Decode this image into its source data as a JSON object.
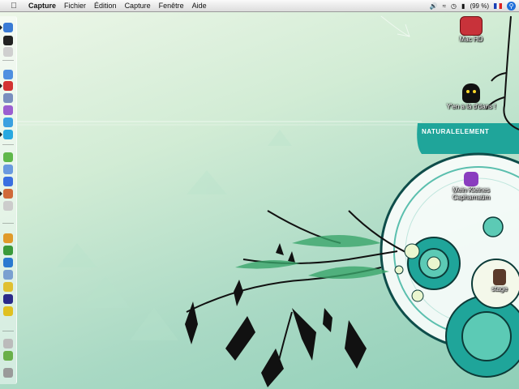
{
  "menubar": {
    "apple_icon": "apple-icon",
    "app_name": "Capture",
    "menus": [
      "Fichier",
      "Édition",
      "Capture",
      "Fenêtre",
      "Aide"
    ],
    "battery": "(99 %)",
    "status_icons": [
      "volume-icon",
      "wifi-icon",
      "clock-icon",
      "battery-icon",
      "flag-fr-icon",
      "spotlight-icon"
    ]
  },
  "desktop": {
    "icons": [
      {
        "label": "Mac HD",
        "icon": "hard-drive-icon"
      },
      {
        "label": "Y'en a là d'dans !",
        "icon": "folder-icon"
      },
      {
        "label": "Mein Kleines Capharnaüm",
        "icon": "folder-icon"
      },
      {
        "label": "stage",
        "icon": "folder-icon"
      }
    ],
    "wallpaper_logo": "NATURALELEMENT"
  },
  "dock": {
    "items": [
      {
        "name": "finder-icon",
        "color": "#3a7bd5"
      },
      {
        "name": "dashboard-icon",
        "color": "#222222"
      },
      {
        "name": "preview-icon",
        "color": "#cfcfcf"
      },
      {
        "name": "safari-icon",
        "color": "#4f8fe0"
      },
      {
        "name": "adium-icon",
        "color": "#d33333"
      },
      {
        "name": "mail-icon",
        "color": "#7a8fbf"
      },
      {
        "name": "ichat-icon",
        "color": "#9b5fd0"
      },
      {
        "name": "network-icon",
        "color": "#3aa0e0"
      },
      {
        "name": "skype-icon",
        "color": "#29a8e0"
      },
      {
        "name": "itunes-icon",
        "color": "#5fb84a"
      },
      {
        "name": "iphoto-icon",
        "color": "#6a9adf"
      },
      {
        "name": "browser-icon",
        "color": "#3a6fe0"
      },
      {
        "name": "utility-icon",
        "color": "#d06a3a"
      },
      {
        "name": "app-icon",
        "color": "#cccccc"
      },
      {
        "name": "pages-icon",
        "color": "#e09a2a"
      },
      {
        "name": "keynote-icon",
        "color": "#3a9a3a"
      },
      {
        "name": "numbers-icon",
        "color": "#2a7ad0"
      },
      {
        "name": "textedit-icon",
        "color": "#7aa0d0"
      },
      {
        "name": "grapher-icon",
        "color": "#e0c030"
      },
      {
        "name": "colors-icon",
        "color": "#2a2a8a"
      },
      {
        "name": "warning-icon",
        "color": "#e0c020"
      },
      {
        "name": "downloads-icon",
        "color": "#bbbbbb"
      },
      {
        "name": "tools-icon",
        "color": "#6ab04a"
      },
      {
        "name": "trash-icon",
        "color": "#9a9a9a"
      }
    ]
  },
  "colors": {
    "accent": "#1fa59a",
    "menubar": "#e6e6e6"
  }
}
